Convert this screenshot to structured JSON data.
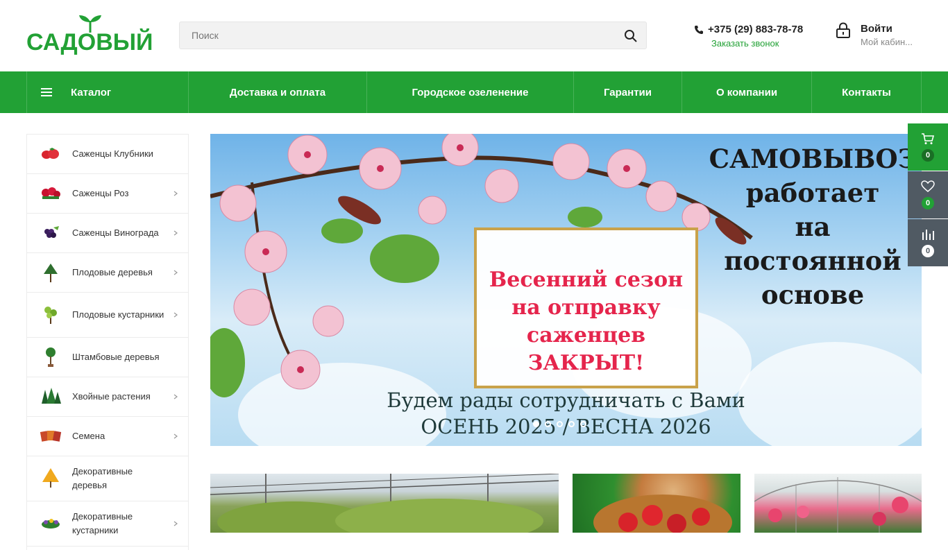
{
  "header": {
    "logo_text": "САДОВЫЙ",
    "search_placeholder": "Поиск",
    "phone": "+375 (29) 883-78-78",
    "callback": "Заказать звонок",
    "login": "Войти",
    "cabinet": "Мой кабин..."
  },
  "nav": {
    "catalog": "Каталог",
    "items": [
      "Доставка и оплата",
      "Городское озеленение",
      "Гарантии",
      "О компании",
      "Контакты"
    ]
  },
  "sidebar": {
    "items": [
      {
        "label": "Саженцы Клубники",
        "icon": "strawberry-icon",
        "has_arrow": false
      },
      {
        "label": "Саженцы Роз",
        "icon": "rose-icon",
        "has_arrow": true
      },
      {
        "label": "Саженцы Винограда",
        "icon": "grape-icon",
        "has_arrow": true
      },
      {
        "label": "Плодовые деревья",
        "icon": "fruit-tree-icon",
        "has_arrow": true
      },
      {
        "label": "Плодовые кустарники",
        "icon": "fruit-bush-icon",
        "has_arrow": true
      },
      {
        "label": "Штамбовые деревья",
        "icon": "standard-tree-icon",
        "has_arrow": false
      },
      {
        "label": "Хвойные растения",
        "icon": "conifer-icon",
        "has_arrow": true
      },
      {
        "label": "Семена",
        "icon": "seeds-icon",
        "has_arrow": true
      },
      {
        "label": "Декоративные деревья",
        "icon": "decorative-tree-icon",
        "has_arrow": false
      },
      {
        "label": "Декоративные кустарники",
        "icon": "decorative-bush-icon",
        "has_arrow": true
      }
    ]
  },
  "banner": {
    "sign_text": [
      "Весенний сезон",
      "на отправку",
      "саженцев",
      "ЗАКРЫТ!"
    ],
    "right_text": [
      "САМОВЫВОЗ",
      "работает",
      "на",
      "постоянной",
      "основе"
    ],
    "bottom_text": [
      "Будем рады сотрудничать с Вами",
      "ОСЕНЬ 2025 / ВЕСНА 2026"
    ],
    "slides": 5,
    "active_slide": 0
  },
  "floating": {
    "cart_count": "0",
    "favorites_count": "0",
    "compare_count": "0"
  },
  "colors": {
    "brand_green": "#22a135",
    "dark_panel": "#505a63",
    "sign_red": "#e5254c"
  }
}
